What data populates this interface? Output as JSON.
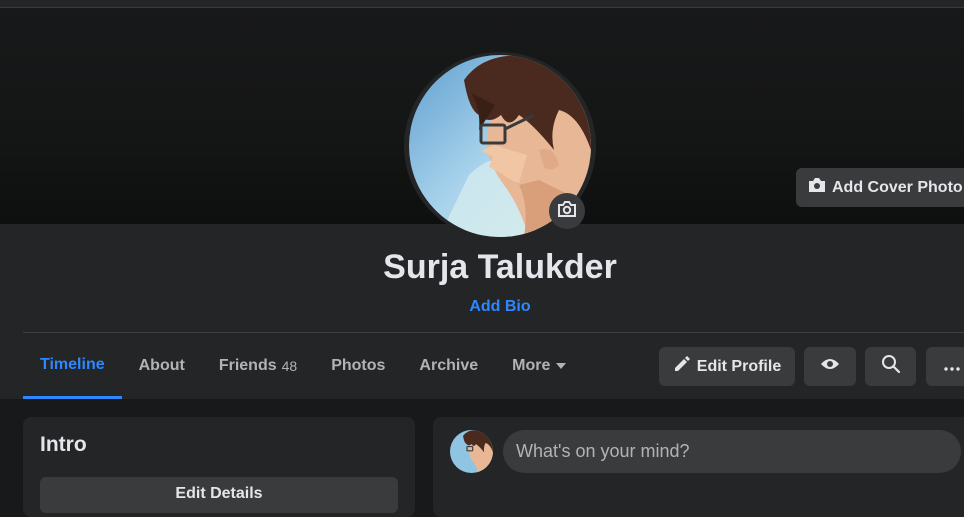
{
  "profile": {
    "name": "Surja Talukder",
    "add_bio_label": "Add Bio",
    "add_cover_label": "Add Cover Photo"
  },
  "tabs": [
    {
      "label": "Timeline",
      "active": true
    },
    {
      "label": "About"
    },
    {
      "label": "Friends",
      "count": "48"
    },
    {
      "label": "Photos"
    },
    {
      "label": "Archive"
    },
    {
      "label": "More"
    }
  ],
  "actions": {
    "edit_profile_label": "Edit Profile",
    "view_icon": "eye-icon",
    "search_icon": "search-icon",
    "more_icon": "ellipsis-icon"
  },
  "intro": {
    "title": "Intro",
    "edit_details_label": "Edit Details"
  },
  "composer": {
    "placeholder": "What's on your mind?"
  },
  "colors": {
    "background": "#18191a",
    "card": "#242526",
    "button": "#3a3b3c",
    "accent": "#2d88ff",
    "text": "#e4e6eb",
    "muted_text": "#b0b3b8"
  }
}
